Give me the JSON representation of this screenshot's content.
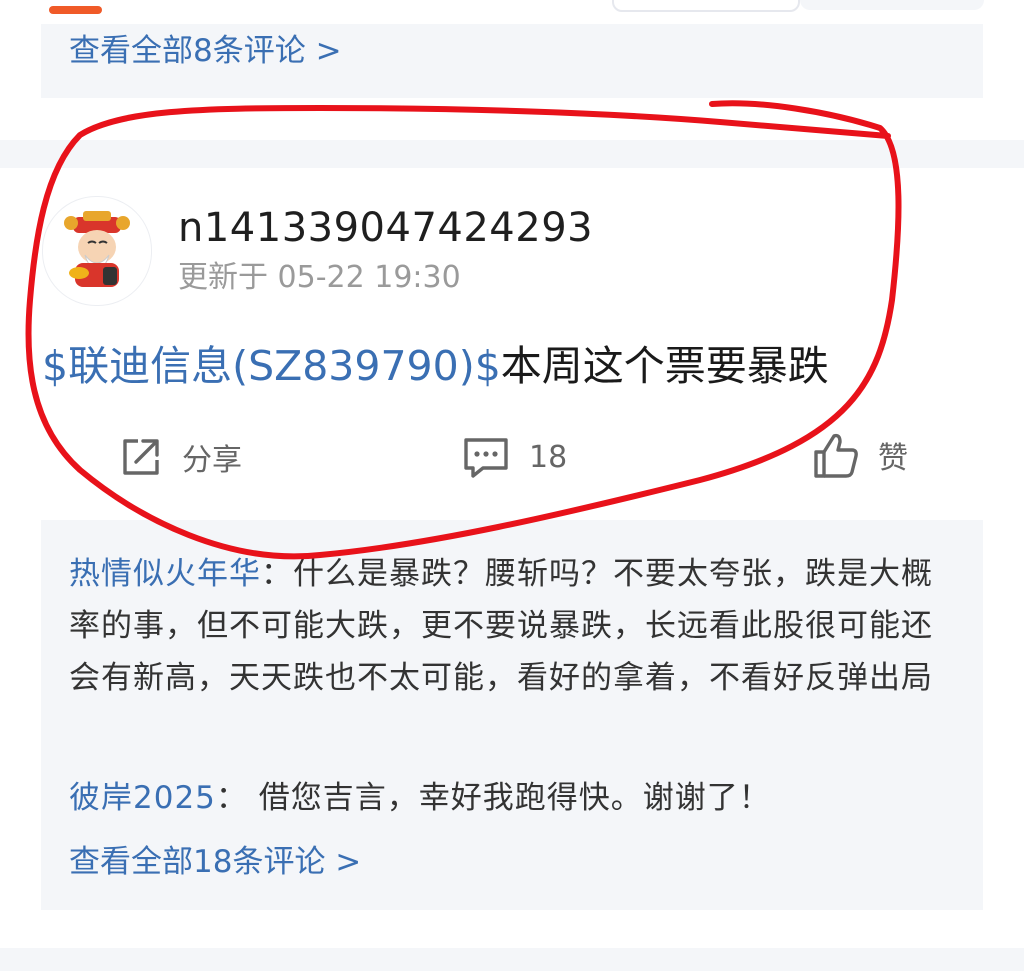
{
  "previous_post": {
    "view_all_label": "查看全部8条评论 >"
  },
  "post": {
    "username": "n141339047424293",
    "updated": "更新于 05-22 19:30",
    "stock_tag": "$联迪信息(SZ839790)$",
    "text": "本周这个票要暴跌",
    "actions": {
      "share_label": "分享",
      "comment_count": "18",
      "like_label": "赞"
    }
  },
  "comments": {
    "items": [
      {
        "author": "热情似火年华",
        "separator": "：",
        "text": "什么是暴跌？腰斩吗？不要太夸张，跌是大概率的事，但不可能大跌，更不要说暴跌，长远看此股很可能还会有新高，天天跌也不太可能，看好的拿着，不看好反弹出局"
      },
      {
        "author": "彼岸2025",
        "separator": "： ",
        "text": "借您吉言，幸好我跑得快。谢谢了！"
      }
    ],
    "view_all_label": "查看全部18条评论 >"
  },
  "colors": {
    "accent_blue": "#3a6fb3",
    "annotation_red": "#e8121a",
    "brand_orange": "#f05a28",
    "panel_bg": "#f4f6f9"
  },
  "icons": {
    "share": "share-icon",
    "comment": "comment-icon",
    "like": "thumbs-up-icon",
    "avatar": "caishen-avatar"
  }
}
